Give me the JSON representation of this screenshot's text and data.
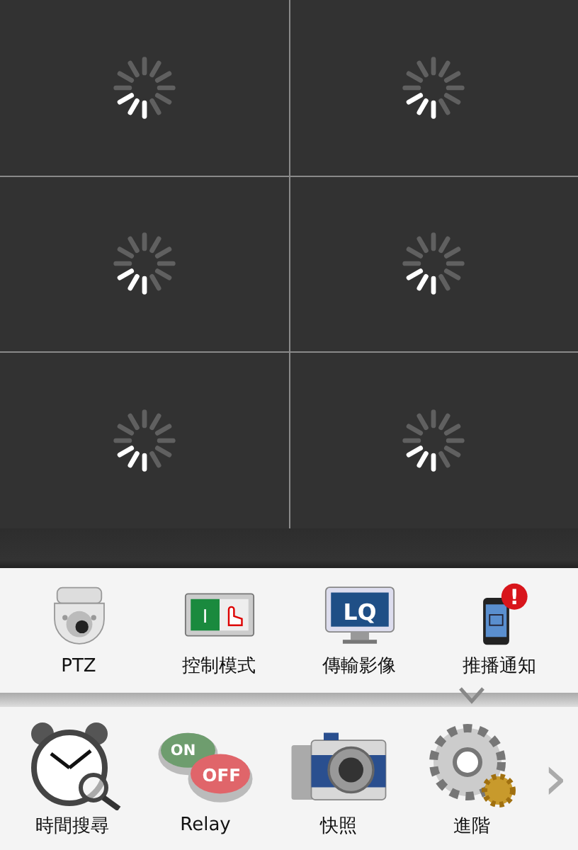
{
  "video_grid": {
    "cells": [
      {
        "kind": "loading"
      },
      {
        "kind": "loading"
      },
      {
        "kind": "loading"
      },
      {
        "kind": "loading"
      },
      {
        "kind": "loading"
      },
      {
        "kind": "loading"
      }
    ]
  },
  "function_bar": {
    "items": [
      {
        "kind": "ptz",
        "label": "PTZ"
      },
      {
        "kind": "control-mode",
        "label": "控制模式",
        "icon_text": "I"
      },
      {
        "kind": "stream-quality",
        "label": "傳輸影像",
        "icon_text": "LQ"
      },
      {
        "kind": "push-notify",
        "label": "推播通知",
        "icon_text": "!"
      }
    ]
  },
  "tool_bar": {
    "items": [
      {
        "kind": "time-search",
        "label": "時間搜尋"
      },
      {
        "kind": "relay",
        "label": "Relay",
        "icon_text": "ON",
        "icon_text_2": "OFF"
      },
      {
        "kind": "snapshot",
        "label": "快照"
      },
      {
        "kind": "advanced",
        "label": "進階"
      }
    ],
    "next": "›"
  }
}
